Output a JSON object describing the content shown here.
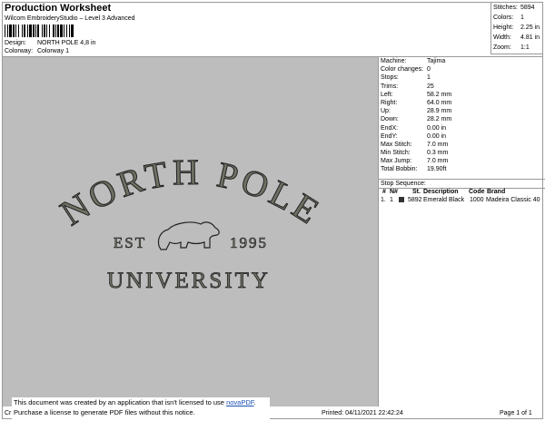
{
  "header": {
    "title": "Production Worksheet",
    "subtitle": "Wilcom EmbroideryStudio – Level 3 Advanced",
    "design_label": "Design:",
    "design_value": "NORTH POLE 4,8 in",
    "colorway_label": "Colorway:",
    "colorway_value": "Colorway 1"
  },
  "stats": {
    "stitches_label": "Stitches:",
    "stitches": "5894",
    "colors_label": "Colors:",
    "colors": "1",
    "height_label": "Height:",
    "height": "2.25 in",
    "width_label": "Width:",
    "width": "4.81 in",
    "zoom_label": "Zoom:",
    "zoom": "1:1"
  },
  "design_art": {
    "line1": "NORTH POLE",
    "left_text": "EST",
    "right_text": "1995",
    "line3": "UNIVERSITY",
    "fill_color": "#6d7263",
    "outline_color": "#222222",
    "background": "#bdbdbd",
    "icon": "polar-bear-icon"
  },
  "machine_info": {
    "rows": [
      {
        "label": "Machine:",
        "value": "Tajima"
      },
      {
        "label": "Color changes:",
        "value": "0"
      },
      {
        "label": "Stops:",
        "value": "1"
      },
      {
        "label": "Trims:",
        "value": "25"
      },
      {
        "label": "Left:",
        "value": "58.2 mm"
      },
      {
        "label": "Right:",
        "value": "64.0 mm"
      },
      {
        "label": "Up:",
        "value": "28.9 mm"
      },
      {
        "label": "Down:",
        "value": "28.2 mm"
      },
      {
        "label": "EndX:",
        "value": "0.00 in"
      },
      {
        "label": "EndY:",
        "value": "0.00 in"
      },
      {
        "label": "Max Stitch:",
        "value": "7.0 mm"
      },
      {
        "label": "Min Stitch:",
        "value": "0.3 mm"
      },
      {
        "label": "Max Jump:",
        "value": "7.0 mm"
      },
      {
        "label": "Total Bobbin:",
        "value": "19.90ft"
      }
    ]
  },
  "stop_sequence": {
    "title": "Stop Sequence:",
    "headers": {
      "stop": "#",
      "num": "N#",
      "st": "St.",
      "description": "Description",
      "code": "Code",
      "brand": "Brand"
    },
    "rows": [
      {
        "stop": "1.",
        "num": "1",
        "st": "5892",
        "description": "Emerald Black",
        "code": "1000",
        "brand": "Madeira Classic 40",
        "swatch_color": "#333333"
      }
    ]
  },
  "notice": {
    "line1_prefix": "This document was created by an application that isn't licensed to use ",
    "link_text": "novaPDF",
    "line1_suffix": ".",
    "line2": "Purchase a license to generate PDF files without this notice."
  },
  "footer": {
    "left": "Cr",
    "printed": "Printed: 04/11/2021 22:42:24",
    "page": "Page 1 of 1"
  }
}
